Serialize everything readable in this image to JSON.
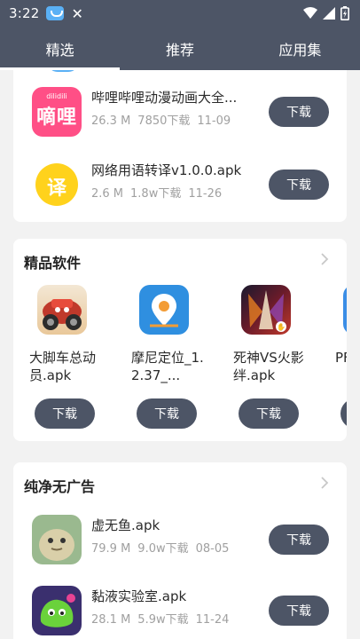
{
  "status_bar": {
    "time": "3:22"
  },
  "tabs": [
    {
      "label": "精选",
      "active": true
    },
    {
      "label": "推荐",
      "active": false
    },
    {
      "label": "应用集",
      "active": false
    }
  ],
  "top_list": {
    "apps": [
      {
        "name": "哔哩哔哩动漫动画大全...",
        "size": "26.3 M",
        "downloads": "7850下载",
        "date": "11-09",
        "icon": "dilidili-app-icon",
        "icon_text": "嘀哩",
        "icon_subtext": "dilidili",
        "button": "下载"
      },
      {
        "name": "网络用语转译v1.0.0.apk",
        "size": "2.6 M",
        "downloads": "1.8w下载",
        "date": "11-26",
        "icon": "translate-app-icon",
        "icon_text": "译",
        "button": "下载"
      }
    ]
  },
  "featured": {
    "title": "精品软件",
    "apps": [
      {
        "name": "大脚车总动员.apk",
        "icon": "bigfoot-car-icon",
        "button": "下载"
      },
      {
        "name": "摩尼定位_1.2.37_...",
        "icon": "location-pin-icon",
        "button": "下载"
      },
      {
        "name": "死神VS火影绊.apk",
        "icon": "bleach-naruto-icon",
        "button": "下载"
      },
      {
        "name": "PF全",
        "icon": "partial-app-icon",
        "button": ""
      }
    ]
  },
  "adfree": {
    "title": "纯净无广告",
    "apps": [
      {
        "name": "虚无鱼.apk",
        "size": "79.9 M",
        "downloads": "9.0w下载",
        "date": "08-05",
        "icon": "fish-app-icon",
        "button": "下载"
      },
      {
        "name": "黏液实验室.apk",
        "size": "28.1 M",
        "downloads": "5.9w下载",
        "date": "11-24",
        "icon": "slime-lab-icon",
        "button": "下载"
      }
    ]
  },
  "colors": {
    "header": "#4d5566",
    "button": "#4d5566",
    "background": "#f2f2f2",
    "dilidili_pink": "#ff4f86",
    "translate_yellow": "#ffd21c"
  }
}
